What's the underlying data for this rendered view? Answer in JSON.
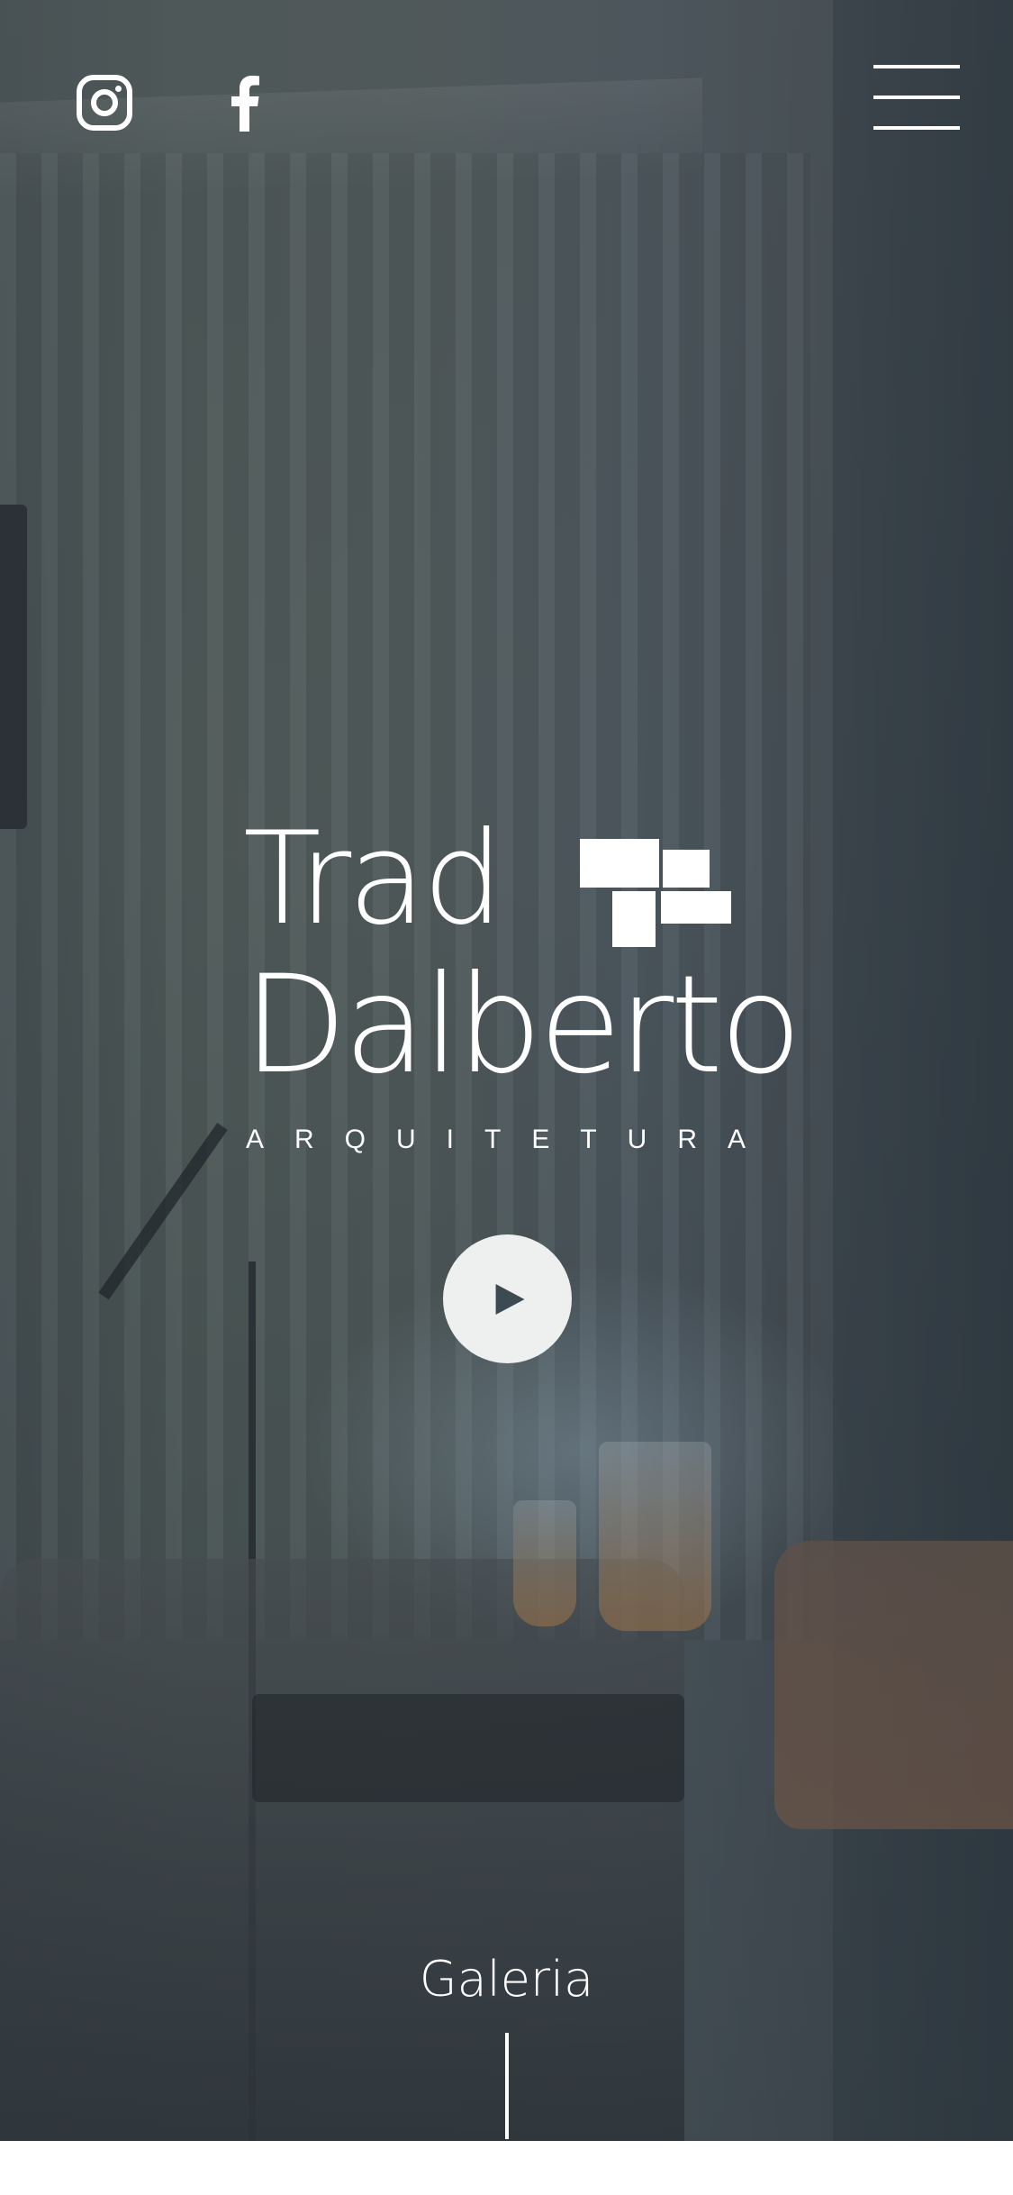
{
  "header": {
    "social": [
      {
        "name": "instagram-icon"
      },
      {
        "name": "facebook-icon"
      }
    ],
    "menu_icon": "menu-icon"
  },
  "logo": {
    "line1": "Trad",
    "line2": "Dalberto",
    "tagline": "ARQUITETURA"
  },
  "hero": {
    "play_icon": "play-icon"
  },
  "footer_link": {
    "label": "Galeria"
  },
  "colors": {
    "text": "#ffffff",
    "play_bg": "#eeefef",
    "play_glyph": "#3d4a52"
  }
}
